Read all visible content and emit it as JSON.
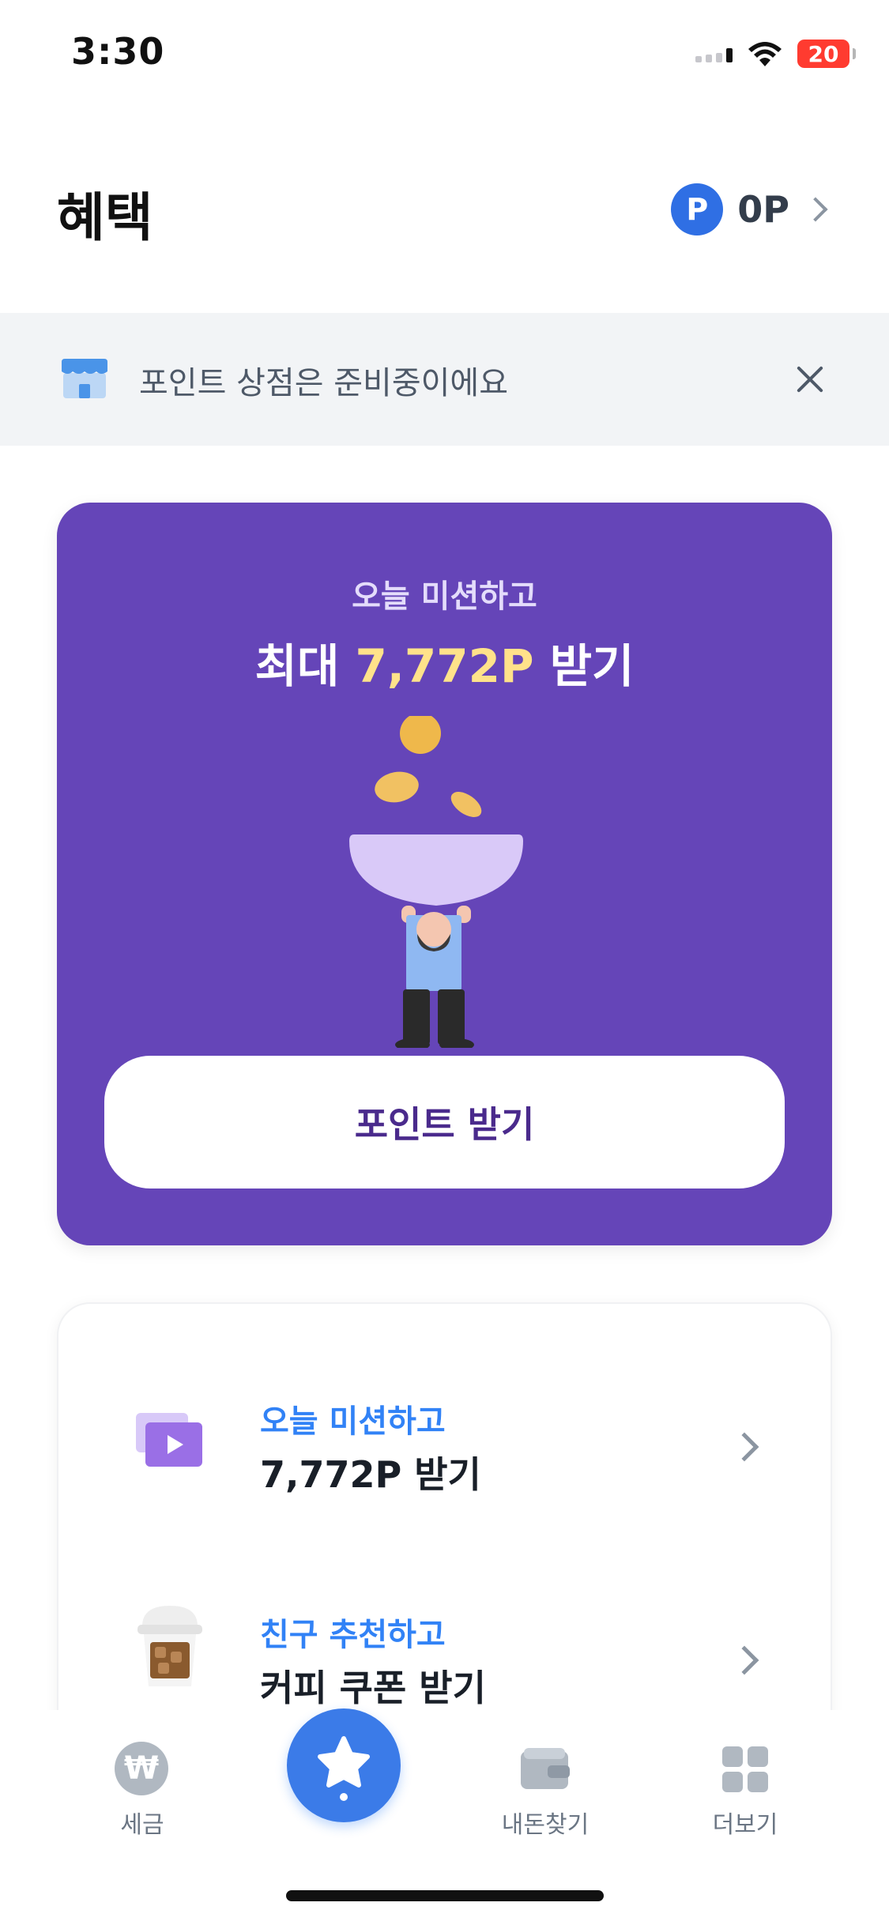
{
  "status_bar": {
    "time": "3:30",
    "battery": "20"
  },
  "header": {
    "title": "혜택",
    "points_badge": "P",
    "points_value": "0P"
  },
  "notice": {
    "icon": "store-icon",
    "text": "포인트 상점은 준비중이에요"
  },
  "promo": {
    "subtitle": "오늘 미션하고",
    "title_prefix": "최대",
    "title_highlight": "7,772P",
    "title_suffix": "받기",
    "button_label": "포인트 받기",
    "illustration": "person-holding-bowl-with-coins"
  },
  "list": {
    "items": [
      {
        "icon": "video-play-icon",
        "subtitle": "오늘 미션하고",
        "title": "7,772P 받기"
      },
      {
        "icon": "coffee-cup-icon",
        "subtitle": "친구 추천하고",
        "title": "커피 쿠폰 받기"
      }
    ]
  },
  "tabs": [
    {
      "label": "세금",
      "icon": "won-icon"
    },
    {
      "label": "",
      "icon": "star-icon",
      "active": true
    },
    {
      "label": "내돈찾기",
      "icon": "wallet-icon"
    },
    {
      "label": "더보기",
      "icon": "grid-icon"
    }
  ],
  "colors": {
    "accent": "#3182f6",
    "promo_bg": "#6545b8",
    "highlight": "#ffe28a"
  }
}
